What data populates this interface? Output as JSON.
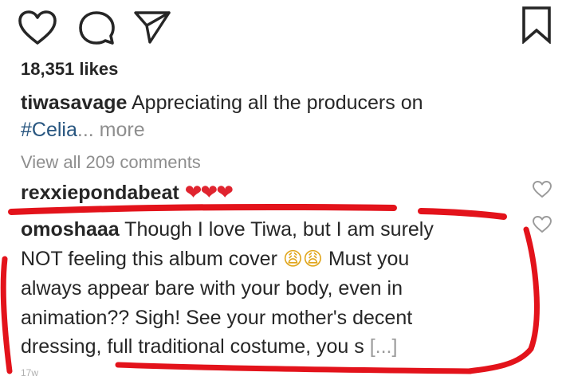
{
  "actions": {
    "like_icon": "heart-outline",
    "comment_icon": "speech-bubble",
    "share_icon": "paper-plane",
    "save_icon": "bookmark"
  },
  "likes": "18,351 likes",
  "caption": {
    "username": "tiwasavage",
    "text": "Appreciating all the producers on",
    "hashtag": "#Celia",
    "more": "... more"
  },
  "view_all_comments": "View all 209 comments",
  "comments": [
    {
      "username": "rexxiepondabeat",
      "text": "❤❤❤"
    },
    {
      "username": "omoshaaa",
      "text_line1": "Though I love Tiwa, but I am surely",
      "text_line2_a": "NOT feeling this album cover",
      "emoji": "😩😩",
      "text_line2_b": "Must you",
      "text_line3": "always appear bare with your body, even in",
      "text_line4": "animation?? Sigh! See your mother's decent",
      "text_line5": "dressing, full traditional costume, you s",
      "truncation": "[...]"
    }
  ],
  "footnote": "17w",
  "colors": {
    "annotation_red": "#e3131b",
    "hashtag_blue": "#27557f",
    "muted_gray": "#8e8e8e",
    "text": "#262626"
  }
}
